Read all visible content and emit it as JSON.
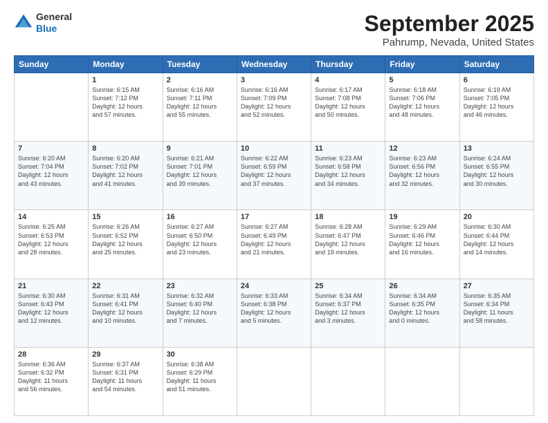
{
  "header": {
    "logo_general": "General",
    "logo_blue": "Blue",
    "title": "September 2025",
    "subtitle": "Pahrump, Nevada, United States"
  },
  "days_of_week": [
    "Sunday",
    "Monday",
    "Tuesday",
    "Wednesday",
    "Thursday",
    "Friday",
    "Saturday"
  ],
  "weeks": [
    [
      {
        "day": "",
        "content": ""
      },
      {
        "day": "1",
        "content": "Sunrise: 6:15 AM\nSunset: 7:12 PM\nDaylight: 12 hours\nand 57 minutes."
      },
      {
        "day": "2",
        "content": "Sunrise: 6:16 AM\nSunset: 7:11 PM\nDaylight: 12 hours\nand 55 minutes."
      },
      {
        "day": "3",
        "content": "Sunrise: 6:16 AM\nSunset: 7:09 PM\nDaylight: 12 hours\nand 52 minutes."
      },
      {
        "day": "4",
        "content": "Sunrise: 6:17 AM\nSunset: 7:08 PM\nDaylight: 12 hours\nand 50 minutes."
      },
      {
        "day": "5",
        "content": "Sunrise: 6:18 AM\nSunset: 7:06 PM\nDaylight: 12 hours\nand 48 minutes."
      },
      {
        "day": "6",
        "content": "Sunrise: 6:19 AM\nSunset: 7:05 PM\nDaylight: 12 hours\nand 46 minutes."
      }
    ],
    [
      {
        "day": "7",
        "content": "Sunrise: 6:20 AM\nSunset: 7:04 PM\nDaylight: 12 hours\nand 43 minutes."
      },
      {
        "day": "8",
        "content": "Sunrise: 6:20 AM\nSunset: 7:02 PM\nDaylight: 12 hours\nand 41 minutes."
      },
      {
        "day": "9",
        "content": "Sunrise: 6:21 AM\nSunset: 7:01 PM\nDaylight: 12 hours\nand 39 minutes."
      },
      {
        "day": "10",
        "content": "Sunrise: 6:22 AM\nSunset: 6:59 PM\nDaylight: 12 hours\nand 37 minutes."
      },
      {
        "day": "11",
        "content": "Sunrise: 6:23 AM\nSunset: 6:58 PM\nDaylight: 12 hours\nand 34 minutes."
      },
      {
        "day": "12",
        "content": "Sunrise: 6:23 AM\nSunset: 6:56 PM\nDaylight: 12 hours\nand 32 minutes."
      },
      {
        "day": "13",
        "content": "Sunrise: 6:24 AM\nSunset: 6:55 PM\nDaylight: 12 hours\nand 30 minutes."
      }
    ],
    [
      {
        "day": "14",
        "content": "Sunrise: 6:25 AM\nSunset: 6:53 PM\nDaylight: 12 hours\nand 28 minutes."
      },
      {
        "day": "15",
        "content": "Sunrise: 6:26 AM\nSunset: 6:52 PM\nDaylight: 12 hours\nand 25 minutes."
      },
      {
        "day": "16",
        "content": "Sunrise: 6:27 AM\nSunset: 6:50 PM\nDaylight: 12 hours\nand 23 minutes."
      },
      {
        "day": "17",
        "content": "Sunrise: 6:27 AM\nSunset: 6:49 PM\nDaylight: 12 hours\nand 21 minutes."
      },
      {
        "day": "18",
        "content": "Sunrise: 6:28 AM\nSunset: 6:47 PM\nDaylight: 12 hours\nand 19 minutes."
      },
      {
        "day": "19",
        "content": "Sunrise: 6:29 AM\nSunset: 6:46 PM\nDaylight: 12 hours\nand 16 minutes."
      },
      {
        "day": "20",
        "content": "Sunrise: 6:30 AM\nSunset: 6:44 PM\nDaylight: 12 hours\nand 14 minutes."
      }
    ],
    [
      {
        "day": "21",
        "content": "Sunrise: 6:30 AM\nSunset: 6:43 PM\nDaylight: 12 hours\nand 12 minutes."
      },
      {
        "day": "22",
        "content": "Sunrise: 6:31 AM\nSunset: 6:41 PM\nDaylight: 12 hours\nand 10 minutes."
      },
      {
        "day": "23",
        "content": "Sunrise: 6:32 AM\nSunset: 6:40 PM\nDaylight: 12 hours\nand 7 minutes."
      },
      {
        "day": "24",
        "content": "Sunrise: 6:33 AM\nSunset: 6:38 PM\nDaylight: 12 hours\nand 5 minutes."
      },
      {
        "day": "25",
        "content": "Sunrise: 6:34 AM\nSunset: 6:37 PM\nDaylight: 12 hours\nand 3 minutes."
      },
      {
        "day": "26",
        "content": "Sunrise: 6:34 AM\nSunset: 6:35 PM\nDaylight: 12 hours\nand 0 minutes."
      },
      {
        "day": "27",
        "content": "Sunrise: 6:35 AM\nSunset: 6:34 PM\nDaylight: 11 hours\nand 58 minutes."
      }
    ],
    [
      {
        "day": "28",
        "content": "Sunrise: 6:36 AM\nSunset: 6:32 PM\nDaylight: 11 hours\nand 56 minutes."
      },
      {
        "day": "29",
        "content": "Sunrise: 6:37 AM\nSunset: 6:31 PM\nDaylight: 11 hours\nand 54 minutes."
      },
      {
        "day": "30",
        "content": "Sunrise: 6:38 AM\nSunset: 6:29 PM\nDaylight: 11 hours\nand 51 minutes."
      },
      {
        "day": "",
        "content": ""
      },
      {
        "day": "",
        "content": ""
      },
      {
        "day": "",
        "content": ""
      },
      {
        "day": "",
        "content": ""
      }
    ]
  ]
}
